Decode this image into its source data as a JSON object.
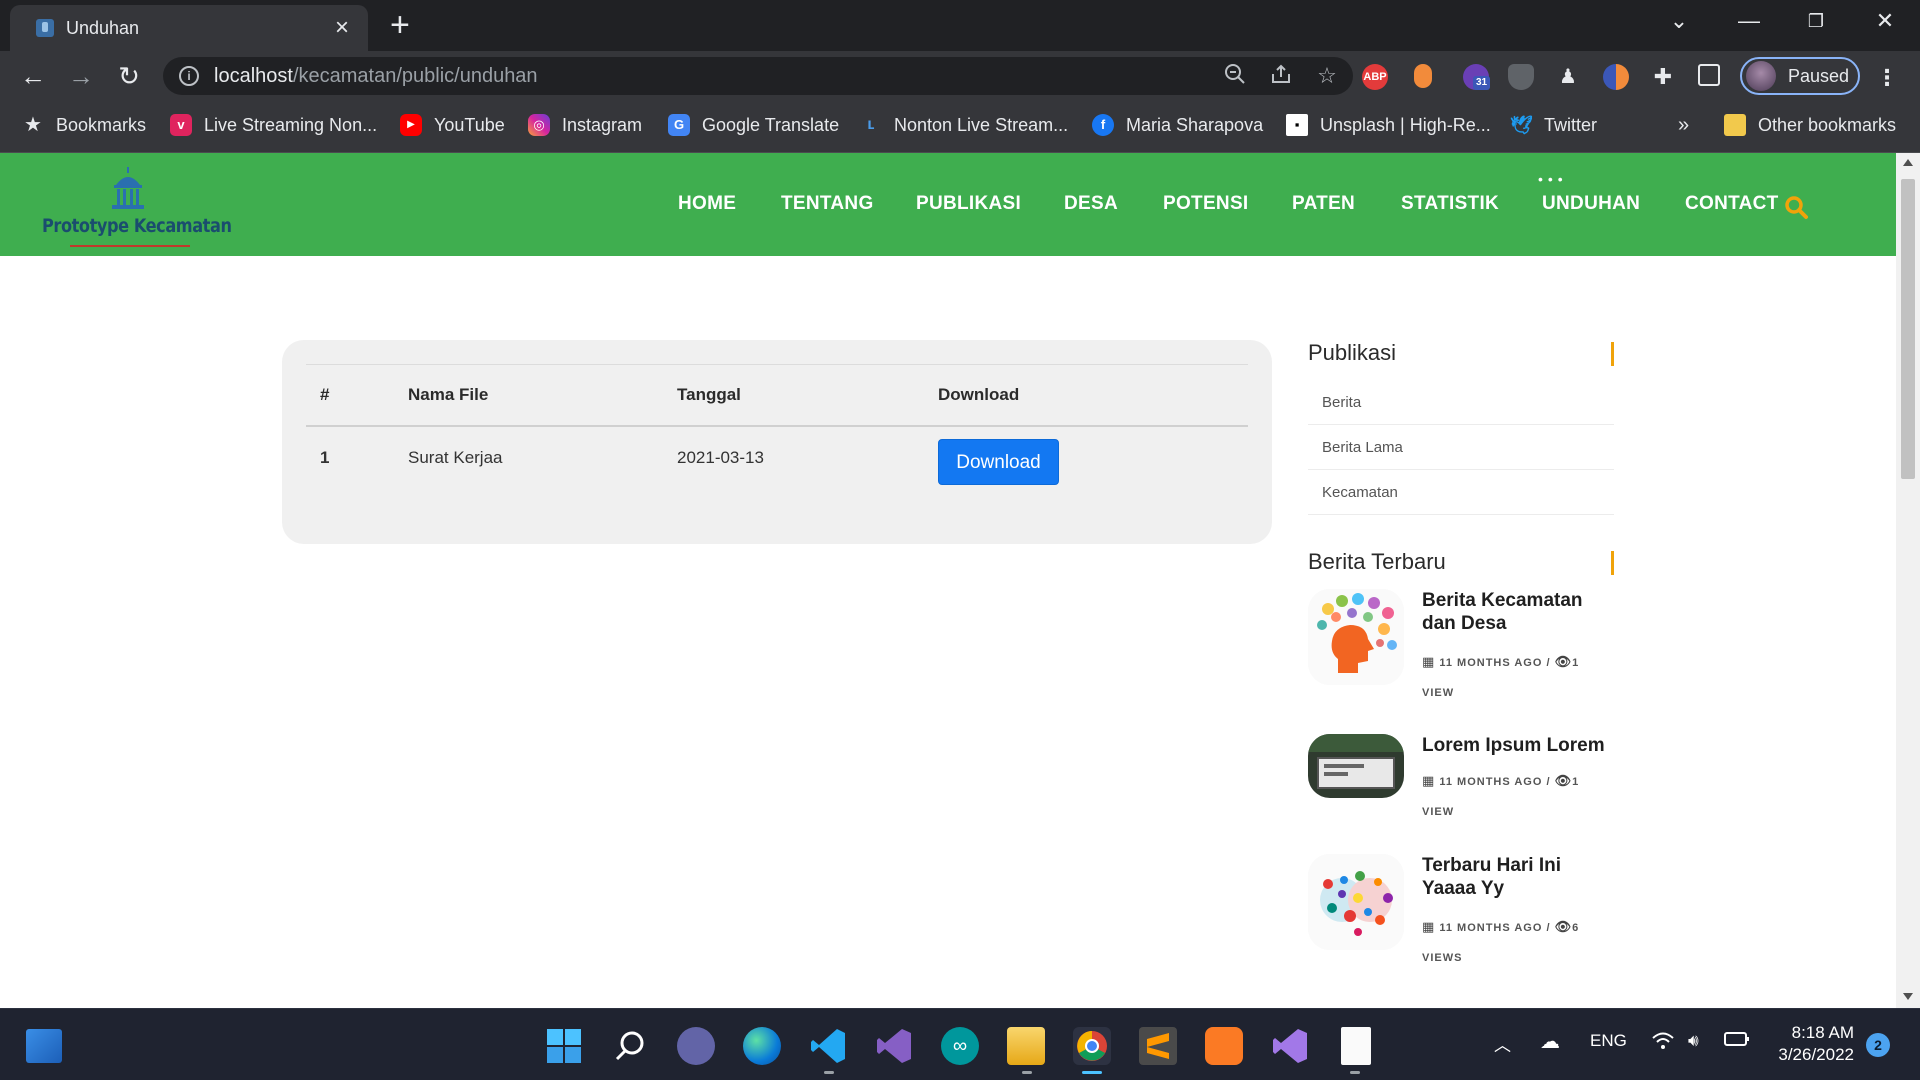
{
  "browser": {
    "tab_title": "Unduhan",
    "url_host": "localhost",
    "url_path": "/kecamatan/public/unduhan",
    "profile_label": "Paused",
    "bookmarks": [
      {
        "label": "Bookmarks",
        "icon": "star-icon"
      },
      {
        "label": "Live Streaming Non...",
        "icon": "vidio-icon"
      },
      {
        "label": "YouTube",
        "icon": "youtube-icon"
      },
      {
        "label": "Instagram",
        "icon": "instagram-icon"
      },
      {
        "label": "Google Translate",
        "icon": "google-translate-icon"
      },
      {
        "label": "Nonton Live Stream...",
        "icon": "live-stream-icon"
      },
      {
        "label": "Maria Sharapova",
        "icon": "facebook-icon"
      },
      {
        "label": "Unsplash | High-Re...",
        "icon": "unsplash-icon"
      },
      {
        "label": "Twitter",
        "icon": "twitter-icon"
      }
    ],
    "other_bookmarks": "Other bookmarks",
    "more_bookmarks": "»",
    "extension_badge": "31",
    "abp_label": "ABP"
  },
  "site": {
    "logo_text": "Prototype Kecamatan",
    "nav": [
      "HOME",
      "TENTANG",
      "PUBLIKASI",
      "DESA",
      "POTENSI",
      "PATEN",
      "STATISTIK",
      "UNDUHAN",
      "CONTACT"
    ]
  },
  "table": {
    "headers": [
      "#",
      "Nama File",
      "Tanggal",
      "Download"
    ],
    "rows": [
      {
        "no": "1",
        "name": "Surat Kerjaa",
        "date": "2021-03-13",
        "button": "Download"
      }
    ]
  },
  "sidebar": {
    "publikasi_title": "Publikasi",
    "publikasi_links": [
      "Berita",
      "Berita Lama",
      "Kecamatan"
    ],
    "berita_title": "Berita Terbaru",
    "posts": [
      {
        "title": "Berita Kecamatan dan Desa",
        "date": "11 MONTHS AGO",
        "views": "1",
        "views_label": "VIEW"
      },
      {
        "title": "Lorem Ipsum Lorem",
        "date": "11 MONTHS AGO",
        "views": "1",
        "views_label": "VIEW"
      },
      {
        "title": "Terbaru Hari Ini Yaaaa Yy",
        "date": "11 MONTHS AGO",
        "views": "6",
        "views_label": "VIEWS"
      }
    ]
  },
  "taskbar": {
    "language": "ENG",
    "time": "8:18 AM",
    "date": "3/26/2022",
    "notifications": "2"
  },
  "colors": {
    "header_green": "#3fae4f",
    "accent_orange": "#f0a30a",
    "button_blue": "#1378f2"
  }
}
